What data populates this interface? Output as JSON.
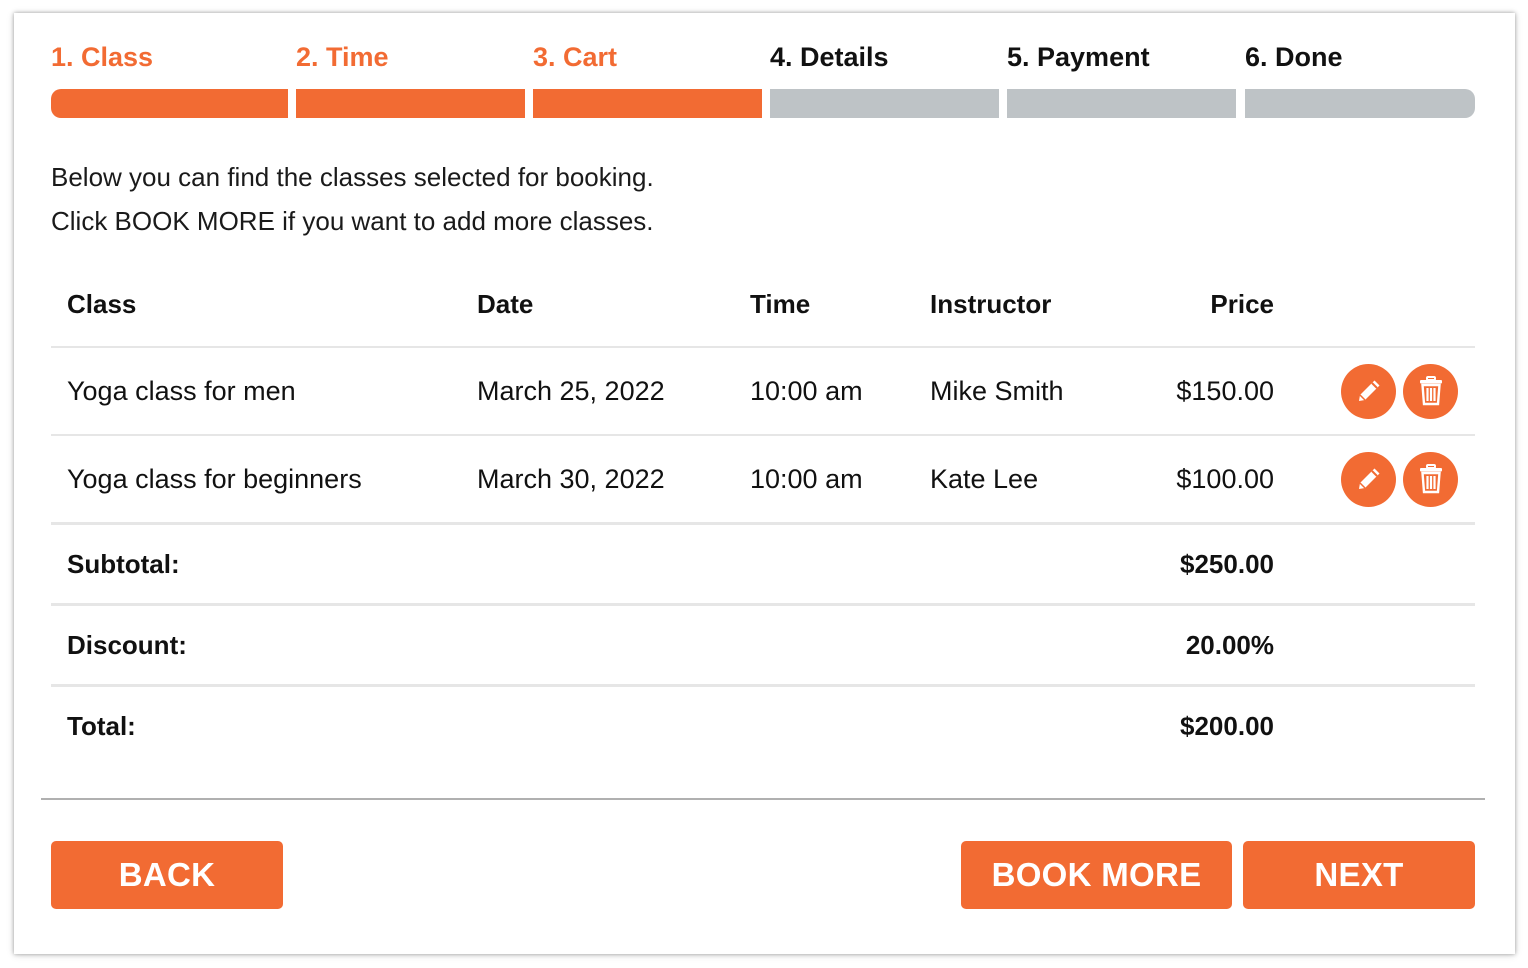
{
  "colors": {
    "accent": "#f26b33",
    "inactive_bar": "#bec3c6",
    "text": "#111111"
  },
  "steps": [
    {
      "label": "1. Class",
      "state": "done"
    },
    {
      "label": "2. Time",
      "state": "done"
    },
    {
      "label": "3. Cart",
      "state": "done"
    },
    {
      "label": "4. Details",
      "state": "todo"
    },
    {
      "label": "5. Payment",
      "state": "todo"
    },
    {
      "label": "6. Done",
      "state": "todo"
    }
  ],
  "intro": {
    "line1": "Below you can find the classes selected for booking.",
    "line2": "Click BOOK MORE if you want to add more classes."
  },
  "table": {
    "headers": {
      "class": "Class",
      "date": "Date",
      "time": "Time",
      "instructor": "Instructor",
      "price": "Price"
    },
    "rows": [
      {
        "class": "Yoga class for men",
        "date": "March 25, 2022",
        "time": "10:00 am",
        "instructor": "Mike Smith",
        "price": "$150.00",
        "edit_icon": "pencil-icon",
        "delete_icon": "trash-icon"
      },
      {
        "class": "Yoga class for beginners",
        "date": "March 30, 2022",
        "time": "10:00 am",
        "instructor": "Kate Lee",
        "price": "$100.00",
        "edit_icon": "pencil-icon",
        "delete_icon": "trash-icon"
      }
    ]
  },
  "summary": {
    "subtotal_label": "Subtotal:",
    "subtotal_value": "$250.00",
    "discount_label": "Discount:",
    "discount_value": "20.00%",
    "total_label": "Total:",
    "total_value": "$200.00"
  },
  "buttons": {
    "back": "BACK",
    "book_more": "BOOK MORE",
    "next": "NEXT"
  }
}
